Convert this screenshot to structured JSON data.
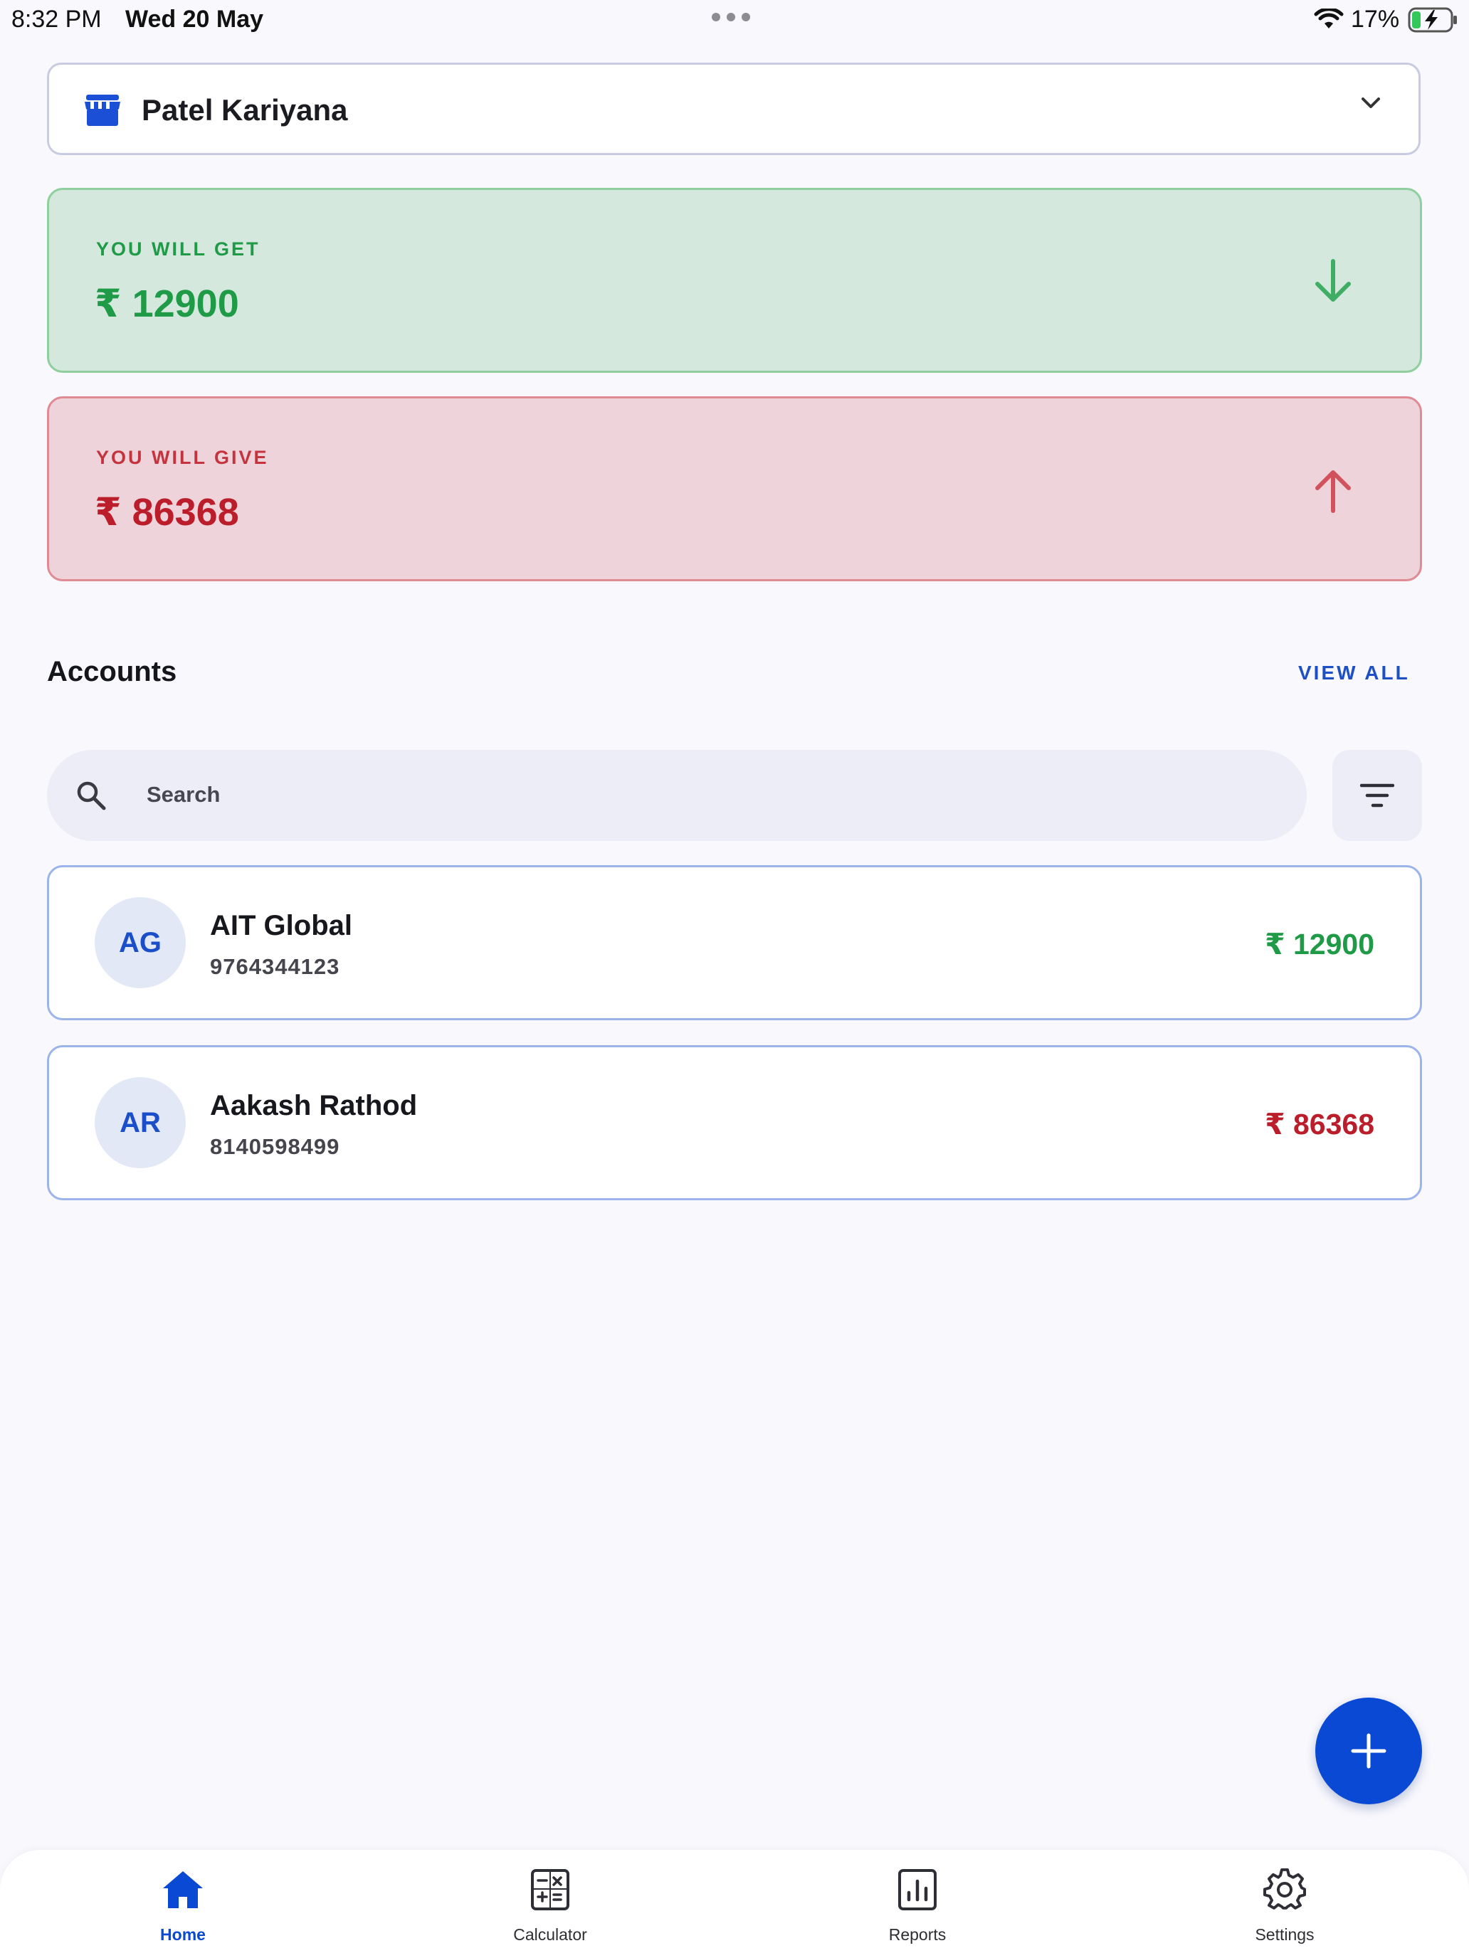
{
  "status_bar": {
    "time": "8:32 PM",
    "date": "Wed 20 May",
    "battery_percent": "17%"
  },
  "shop": {
    "name": "Patel Kariyana"
  },
  "summary": {
    "get": {
      "label": "YOU WILL GET",
      "amount": "₹ 12900"
    },
    "give": {
      "label": "YOU WILL GIVE",
      "amount": "₹ 86368"
    }
  },
  "accounts": {
    "title": "Accounts",
    "view_all": "VIEW ALL",
    "search_placeholder": "Search",
    "items": [
      {
        "initials": "AG",
        "name": "AIT Global",
        "phone": "9764344123",
        "amount": "₹ 12900",
        "status": "receivable"
      },
      {
        "initials": "AR",
        "name": "Aakash Rathod",
        "phone": "8140598499",
        "amount": "₹ 86368",
        "status": "payable"
      }
    ]
  },
  "nav": {
    "home": "Home",
    "calculator": "Calculator",
    "reports": "Reports",
    "settings": "Settings",
    "active": "home"
  },
  "colors": {
    "primary": "#0a49d4",
    "positive": "#1f9a46",
    "negative": "#bb1d2a",
    "positive_bg": "#d4e8de",
    "negative_bg": "#eed3da",
    "background": "#f8f8fd"
  }
}
